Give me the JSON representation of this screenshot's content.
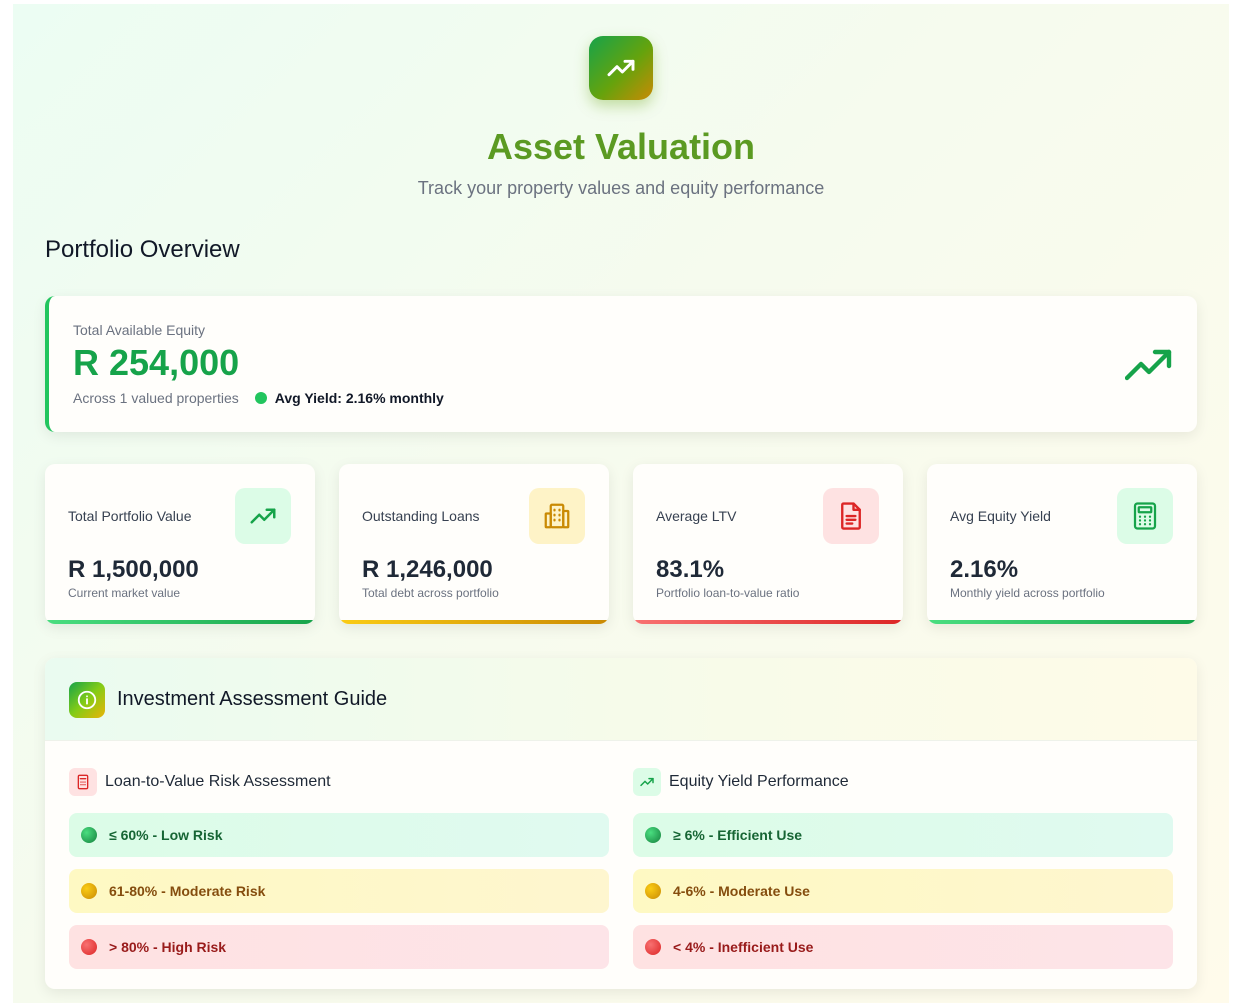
{
  "header": {
    "icon": "trending-up-icon",
    "title": "Asset Valuation",
    "subtitle": "Track your property values and equity performance"
  },
  "overview": {
    "section_title": "Portfolio Overview",
    "equity": {
      "label": "Total Available Equity",
      "value": "R 254,000",
      "across": "Across 1 valued properties",
      "avg_yield": "Avg Yield: 2.16% monthly",
      "accent": "#22c55e"
    },
    "stats": [
      {
        "label": "Total Portfolio Value",
        "value": "R 1,500,000",
        "desc": "Current market value",
        "icon": "trending-up-icon",
        "bar": "#22c55e"
      },
      {
        "label": "Outstanding Loans",
        "value": "R 1,246,000",
        "desc": "Total debt across portfolio",
        "icon": "building-icon",
        "bar": "#eab308"
      },
      {
        "label": "Average LTV",
        "value": "83.1%",
        "desc": "Portfolio loan-to-value ratio",
        "icon": "document-icon",
        "bar": "#ef4444"
      },
      {
        "label": "Avg Equity Yield",
        "value": "2.16%",
        "desc": "Monthly yield across portfolio",
        "icon": "calculator-icon",
        "bar": "#22c55e"
      }
    ]
  },
  "guide": {
    "title": "Investment Assessment Guide",
    "icon": "info-icon",
    "ltv": {
      "title": "Loan-to-Value Risk Assessment",
      "items": [
        "≤ 60% - Low Risk",
        "61-80% - Moderate Risk",
        "> 80% - High Risk"
      ]
    },
    "yield": {
      "title": "Equity Yield Performance",
      "items": [
        "≥ 6% - Efficient Use",
        "4-6% - Moderate Use",
        "< 4% - Inefficient Use"
      ]
    }
  }
}
